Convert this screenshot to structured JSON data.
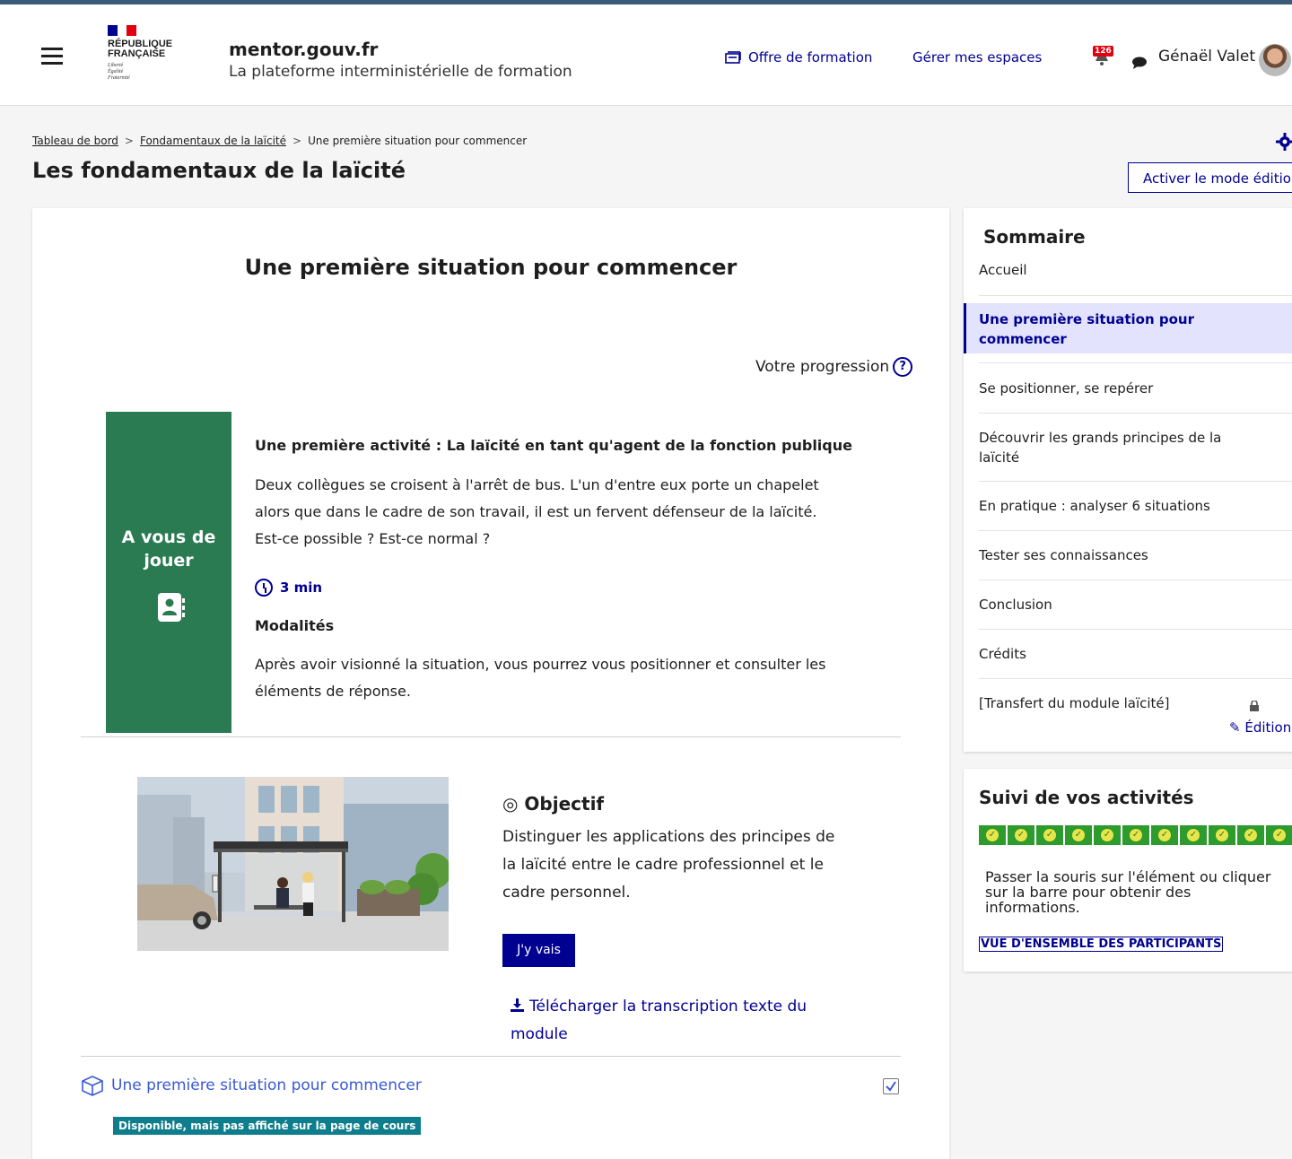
{
  "header": {
    "logo_lines": [
      "RÉPUBLIQUE",
      "FRANÇAISE"
    ],
    "devise": [
      "Liberté",
      "Égalité",
      "Fraternité"
    ],
    "site_name": "mentor.gouv.fr",
    "site_subtitle": "La plateforme interministérielle de formation",
    "nav": {
      "offre": "Offre de formation",
      "espaces": "Gérer mes espaces"
    },
    "notifications_count": "126",
    "user_name": "Génaël Valet",
    "flag_colors": [
      "#000091",
      "#ffffff",
      "#e1000f"
    ]
  },
  "breadcrumb": {
    "home": "Tableau de bord",
    "course": "Fondamentaux de la laïcité",
    "current": "Une première situation pour commencer",
    "separator": ">"
  },
  "page_title": "Les fondamentaux de la laïcité",
  "edit_mode_button": "Activer le mode édition",
  "main": {
    "section_title": "Une première situation pour commencer",
    "progress_label": "Votre progression",
    "progress_help": "?",
    "card_label": "A vous de jouer",
    "activity_title": "Une première activité : La laïcité en tant qu'agent de la fonction publique",
    "activity_desc": "Deux collègues se croisent à l'arrêt de bus. L'un d'entre eux porte un chapelet alors que dans le cadre de son travail, il est un fervent défenseur de la laïcité. Est-ce possible ? Est-ce normal ?",
    "duration": "3 min",
    "modalites_title": "Modalités",
    "modalites_desc": "Après avoir visionné la situation, vous pourrez vous positionner et consulter les éléments de réponse.",
    "objectif_title": "◎ Objectif",
    "objectif_desc": "Distinguer les applications des principes de la laïcité entre le cadre professionnel et le cadre personnel.",
    "go_button": "J'y vais",
    "download_link": "Télécharger la transcription texte du module",
    "activity_link": "Une première situation pour commencer",
    "availability_tag": "Disponible, mais pas affiché sur la page de cours",
    "card_color": "#2a7a52"
  },
  "sommaire": {
    "title": "Sommaire",
    "items": [
      "Accueil",
      "Une première situation pour commencer",
      "Se positionner, se repérer",
      "Découvrir les grands principes de la laïcité",
      "En pratique : analyser 6 situations",
      "Tester ses connaissances",
      "Conclusion",
      "Crédits",
      "[Transfert du module laïcité]"
    ],
    "active_index": 1,
    "edit_link": "✎ Édition"
  },
  "suivi": {
    "title": "Suivi de vos activités",
    "completed_cells": 11,
    "help_text": "Passer la souris sur l'élément ou cliquer sur la barre pour obtenir des informations.",
    "overview_link": "VUE D'ENSEMBLE DES PARTICIPANTS",
    "completed_color": "#2d9b2d"
  }
}
